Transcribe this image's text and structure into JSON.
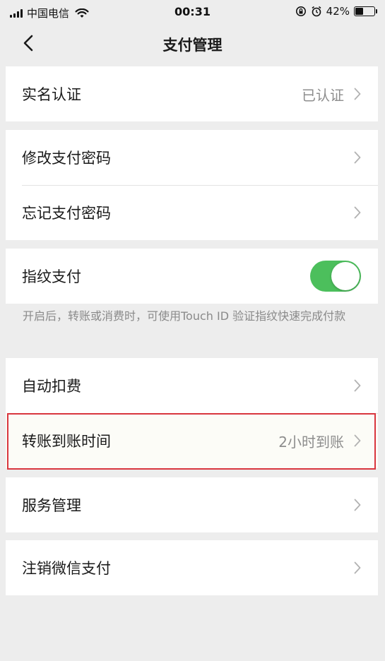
{
  "status_bar": {
    "carrier": "中国电信",
    "time": "00:31",
    "battery": "42%",
    "battery_level": 0.42
  },
  "nav": {
    "title": "支付管理"
  },
  "groups": {
    "identity": {
      "label": "实名认证",
      "value": "已认证"
    },
    "password": {
      "change_label": "修改支付密码",
      "forgot_label": "忘记支付密码"
    },
    "fingerprint": {
      "label": "指纹支付",
      "enabled": true,
      "hint": "开启后，转账或消费时，可使用Touch ID 验证指纹快速完成付款"
    },
    "auto_deduct": {
      "label": "自动扣费"
    },
    "transfer_time": {
      "label": "转账到账时间",
      "value": "2小时到账"
    },
    "service": {
      "label": "服务管理"
    },
    "cancel": {
      "label": "注销微信支付"
    }
  },
  "colors": {
    "toggle_on": "#4cbf5c",
    "highlight_border": "#d9363e",
    "background": "#ededed"
  }
}
